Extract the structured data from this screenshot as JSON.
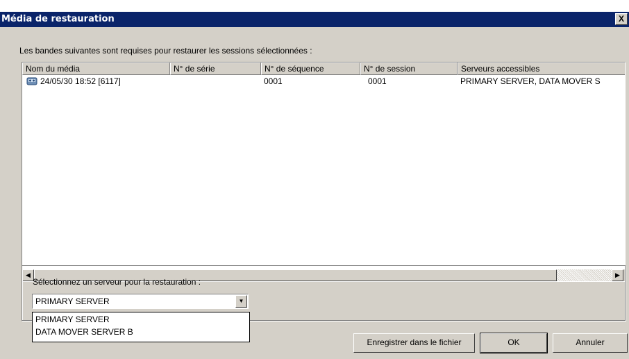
{
  "window": {
    "title": "Média de restauration",
    "close_label": "X"
  },
  "intro_text": "Les bandes suivantes sont requises pour restaurer les sessions sélectionnées :",
  "table": {
    "columns": [
      "Nom du média",
      "N° de série",
      "N° de séquence",
      "N° de session",
      "Serveurs accessibles"
    ],
    "rows": [
      {
        "icon": "tape-media-icon",
        "media_name": "24/05/30 18:52 [6117]",
        "serial": "",
        "sequence": "0001",
        "session": "0001",
        "servers": "PRIMARY SERVER, DATA MOVER S"
      }
    ]
  },
  "server_select": {
    "label": "Sélectionnez un serveur pour la restauration :",
    "value": "PRIMARY SERVER",
    "options": [
      "PRIMARY SERVER",
      "DATA MOVER SERVER B"
    ]
  },
  "buttons": {
    "save": "Enregistrer dans le fichier",
    "ok": "OK",
    "cancel": "Annuler"
  },
  "colors": {
    "titlebar": "#0a246a",
    "dialog_bg": "#d4d0c8"
  }
}
